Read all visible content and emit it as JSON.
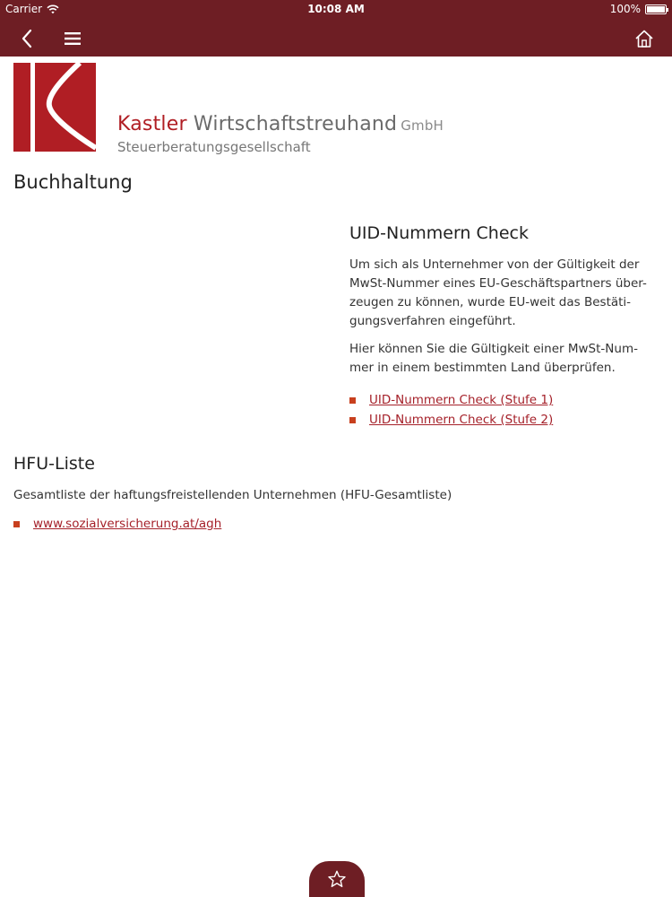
{
  "status_bar": {
    "carrier": "Carrier",
    "time": "10:08 AM",
    "battery": "100%",
    "battery_level": 1.0
  },
  "nav": {
    "icons": [
      "back-chevron-icon",
      "menu-icon",
      "home-icon"
    ]
  },
  "logo": {
    "name_part1": "Kastler",
    "name_part2": "Wirtschaftstreuhand",
    "name_suffix": "GmbH",
    "subtitle": "Steuerberatungsgesellschaft"
  },
  "page": {
    "title": "Buchhaltung"
  },
  "uid_check": {
    "title": "UID-Nummern Check",
    "lines1": [
      "Um sich als Unternehmer von der Gültigkeit der",
      "MwSt-Nummer eines EU-Geschäftspartners über-",
      "zeugen zu können, wurde EU-weit das Bestäti-",
      "gungsverfahren eingeführt."
    ],
    "lines2": [
      "Hier können Sie die Gültigkeit einer MwSt-Num-",
      "mer in einem bestimmten Land überprüfen."
    ],
    "links": [
      {
        "label": "UID-Nummern Check (Stufe 1)"
      },
      {
        "label": "UID-Nummern Check (Stufe 2)"
      }
    ]
  },
  "hfu": {
    "title": "HFU-Liste",
    "description": "Gesamtliste der haftungsfreistellenden Unternehmen (HFU-Gesamtliste)",
    "link": "www.sozialversicherung.at/agh"
  },
  "favorites": {
    "icon": "star-icon"
  },
  "colors": {
    "brand": "#6e1e24",
    "logo_red": "#b01e24",
    "link": "#a5212a",
    "bullet": "#c8401e"
  }
}
